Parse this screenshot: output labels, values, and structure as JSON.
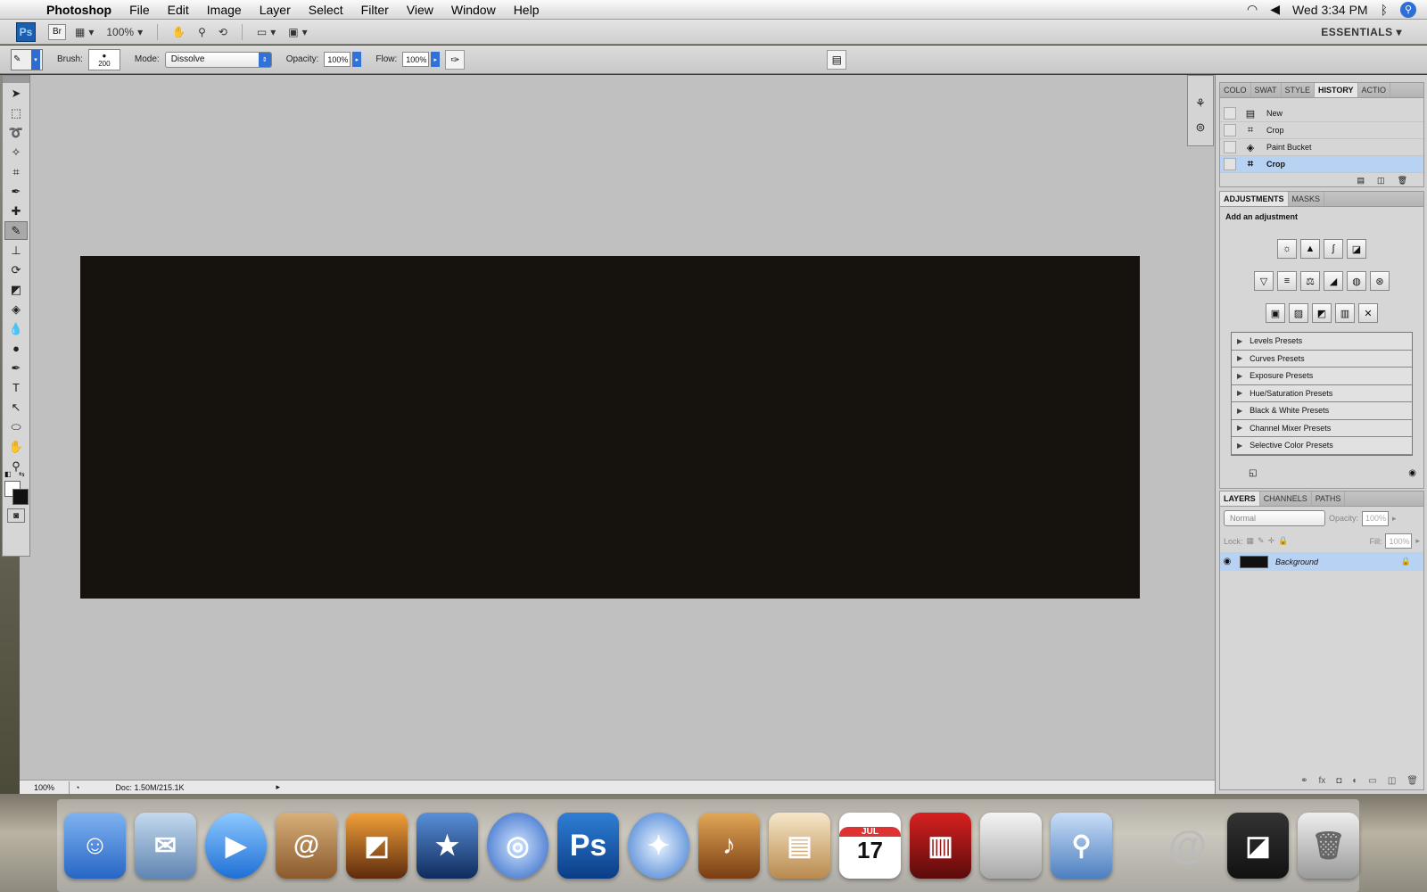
{
  "menubar": {
    "app_name": "Photoshop",
    "items": [
      "File",
      "Edit",
      "Image",
      "Layer",
      "Select",
      "Filter",
      "View",
      "Window",
      "Help"
    ],
    "clock": "Wed 3:34 PM"
  },
  "appbar": {
    "ps_label": "Ps",
    "bridge_label": "Br",
    "zoom": "100%",
    "workspace": "ESSENTIALS"
  },
  "options": {
    "brush_label": "Brush:",
    "brush_size": "200",
    "mode_label": "Mode:",
    "mode_value": "Dissolve",
    "opacity_label": "Opacity:",
    "opacity_value": "100%",
    "flow_label": "Flow:",
    "flow_value": "100%"
  },
  "status": {
    "zoom": "100%",
    "doc": "Doc: 1.50M/215.1K"
  },
  "history_panel": {
    "tabs": [
      "COLO",
      "SWAT",
      "STYLE",
      "HISTORY",
      "ACTIO"
    ],
    "active_tab": "HISTORY",
    "rows": [
      {
        "label": "New",
        "icon": "document-icon",
        "glyph": "▤"
      },
      {
        "label": "Crop",
        "icon": "crop-icon",
        "glyph": "⌗"
      },
      {
        "label": "Paint Bucket",
        "icon": "paint-bucket-icon",
        "glyph": "◈"
      },
      {
        "label": "Crop",
        "icon": "crop-icon",
        "glyph": "⌗"
      }
    ],
    "selected_index": 3
  },
  "adjustments_panel": {
    "tabs": [
      "ADJUSTMENTS",
      "MASKS"
    ],
    "title": "Add an adjustment",
    "presets": [
      "Levels Presets",
      "Curves Presets",
      "Exposure Presets",
      "Hue/Saturation Presets",
      "Black & White Presets",
      "Channel Mixer Presets",
      "Selective Color Presets"
    ]
  },
  "layers_panel": {
    "tabs": [
      "LAYERS",
      "CHANNELS",
      "PATHS"
    ],
    "blend_mode": "Normal",
    "opacity_label": "Opacity:",
    "opacity_value": "100%",
    "lock_label": "Lock:",
    "fill_label": "Fill:",
    "fill_value": "100%",
    "layer_name": "Background"
  },
  "dock": {
    "ps_label": "Ps",
    "calendar_month": "JUL",
    "calendar_day": "17"
  },
  "colors": {
    "canvas": "#16130f",
    "workspace": "#c0c0c0",
    "selection": "#b8d2f4",
    "accent": "#3072d6"
  }
}
